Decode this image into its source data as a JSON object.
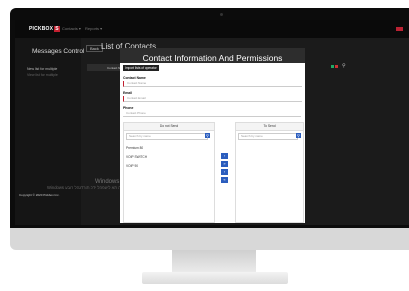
{
  "app": {
    "logo_text": "PICKBOX",
    "logo_badge": "S",
    "nav_item_1": "Contacts ▾",
    "nav_item_2": "Reports ▾"
  },
  "sidebar": {
    "title": "Messages Control",
    "item_active": "New list for multiple",
    "item_secondary": "View list for multiple"
  },
  "main": {
    "back_label": "Back",
    "title": "List of Contacts",
    "strip_label": "Contact Name"
  },
  "modal": {
    "title": "Contact Information And Permissions",
    "import_label": "Import lists of operator",
    "contact_name_label": "Contact Name",
    "contact_name_placeholder": "Contact Name",
    "email_label": "Email",
    "email_placeholder": "Contact Email",
    "phone_label": "Phone",
    "phone_placeholder": "Contact Phone",
    "left_column_title": "Do not Send",
    "right_column_title": "To Send",
    "search_placeholder_left": "Search by name",
    "search_placeholder_right": "Search by name",
    "left_items": [
      "Premium 80",
      "VOIP SWITCH",
      "VOIP 90"
    ],
    "arrows": [
      "›",
      "»",
      "‹",
      "«"
    ]
  },
  "overlay": {
    "windows_line_1": "Windows לש ןוכדעה",
    "windows_line_2": "Windows לש ןוכדעה תא ליעפהל ידכ תורדגהל רובע"
  },
  "footer": {
    "copyright": "Copyright © 2020 Pickbox Inc."
  },
  "colors": {
    "brand": "#c21f2f",
    "accent": "#2b5dbe",
    "dark": "#1b1b1b"
  }
}
